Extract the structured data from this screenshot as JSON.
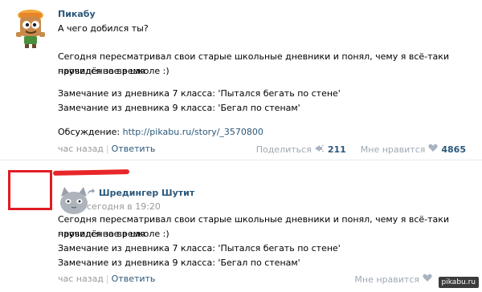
{
  "post1": {
    "author": "Пикабу",
    "question": "А чего добился ты?",
    "body_line1": "Сегодня пересматривал свои старые школьные дневники и понял, чему я всё-таки научился за время",
    "body_line2": "проведённое в школе :)",
    "remark1": "Замечание из дневника 7 класса: 'Пытался бегать по стене'",
    "remark2": "Замечание из дневника 9 класса: 'Бегал по стенам'",
    "discussion_label": "Обсуждение: ",
    "discussion_link": "http://pikabu.ru/story/_3570800",
    "time": "час назад",
    "reply": "Ответить",
    "share_label": "Поделиться",
    "share_count": "211",
    "like_label": "Мне нравится",
    "like_count": "4865"
  },
  "post2": {
    "repost_author": "Шредингер Шутит",
    "repost_time": "сегодня в 19:20",
    "body_line1": "Сегодня пересматривал свои старые школьные дневники и понял, чему я всё-таки научился за время",
    "body_line2": "проведённое в школе :)",
    "remark1": "Замечание из дневника 7 класса: 'Пытался бегать по стене'",
    "remark2": "Замечание из дневника 9 класса: 'Бегал по стенам'",
    "time": "час назад",
    "reply": "Ответить",
    "like_label": "Мне нравится",
    "watermark": "pikabu.ru"
  },
  "colors": {
    "link": "#2b587a",
    "muted": "#999999",
    "censor_red": "#e11c24"
  },
  "icons": [
    "pikabu-mascot-avatar",
    "megaphone-icon",
    "heart-icon",
    "repost-arrow-icon",
    "cat-avatar"
  ]
}
